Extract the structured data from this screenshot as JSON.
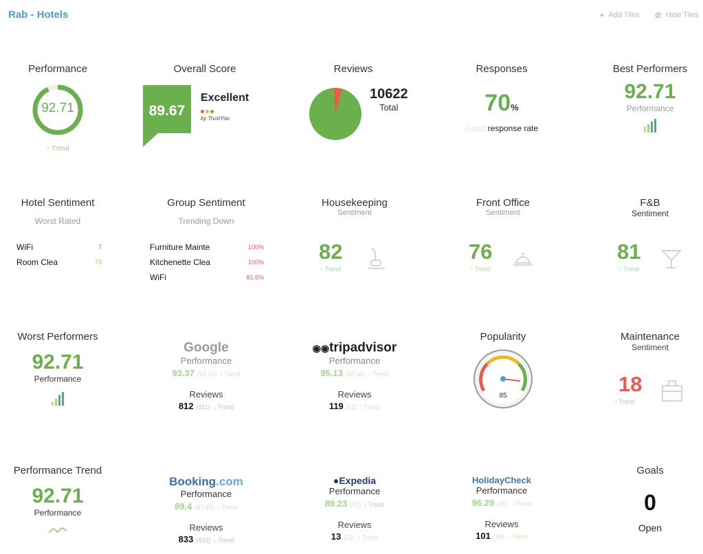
{
  "header": {
    "title": "Rab - Hotels",
    "add_tiles": "Add Tiles",
    "hide_tiles": "Hide Tiles"
  },
  "colors": {
    "green": "#6ab04c",
    "red": "#e85c4a",
    "blue": "#4aa0c8"
  },
  "performance": {
    "title": "Performance",
    "value": "92.71",
    "ring_fraction": 0.93,
    "trend": "Trend"
  },
  "overall_score": {
    "title": "Overall Score",
    "value": "89.67",
    "label": "Excellent",
    "by": "by TrustYou"
  },
  "reviews": {
    "title": "Reviews",
    "total": "10622",
    "total_label": "Total",
    "pie_negative_fraction": 0.05
  },
  "responses": {
    "title": "Responses",
    "value": "70",
    "unit": "%",
    "good": "Good",
    "rate_label": "response rate"
  },
  "best_performers": {
    "title": "Best Performers",
    "value": "92.71",
    "label": "Performance"
  },
  "hotel_sentiment": {
    "title": "Hotel Sentiment",
    "subtitle": "Worst Rated",
    "rows": [
      {
        "name": "WiFi",
        "value": "7"
      },
      {
        "name": "Room Clea",
        "value": "75"
      }
    ]
  },
  "group_sentiment": {
    "title": "Group Sentiment",
    "subtitle": "Trending Down",
    "rows": [
      {
        "name": "Furniture Mainte",
        "value": "100%"
      },
      {
        "name": "Kitchenette Clea",
        "value": "100%"
      },
      {
        "name": "WiFi",
        "value": "81.6%"
      }
    ]
  },
  "housekeeping": {
    "title": "Housekeeping",
    "subtitle": "Sentiment",
    "value": "82",
    "trend": "Trend"
  },
  "front_office": {
    "title": "Front Office",
    "subtitle": "Sentiment",
    "value": "76",
    "trend": "Trend"
  },
  "fnb": {
    "title": "F&B",
    "subtitle": "Sentiment",
    "value": "81",
    "trend": "Trend"
  },
  "worst_performers": {
    "title": "Worst Performers",
    "value": "92.71",
    "label": "Performance"
  },
  "google": {
    "logo": "Google",
    "perf_label": "Performance",
    "perf_value": "93.37",
    "perf_aux": "(93.14)",
    "perf_trend": "Trend",
    "reviews_label": "Reviews",
    "reviews_value": "812",
    "reviews_aux": "(811)",
    "reviews_trend": "Trend"
  },
  "tripadvisor": {
    "logo": "tripadvisor",
    "perf_label": "Performance",
    "perf_value": "95.13",
    "perf_aux": "(97.44)",
    "perf_trend": "Trend",
    "reviews_label": "Reviews",
    "reviews_value": "119",
    "reviews_aux": "(11)",
    "reviews_trend": "Trend"
  },
  "popularity": {
    "title": "Popularity",
    "value": "85"
  },
  "maintenance": {
    "title": "Maintenance",
    "subtitle": "Sentiment",
    "value": "18",
    "trend": "Trend"
  },
  "performance_trend": {
    "title": "Performance Trend",
    "value": "92.71",
    "label": "Performance"
  },
  "booking": {
    "logo_a": "Booking",
    "logo_b": ".com",
    "perf_label": "Performance",
    "perf_value": "89.4",
    "perf_aux": "(87.85)",
    "perf_trend": "Trend",
    "reviews_label": "Reviews",
    "reviews_value": "833",
    "reviews_aux": "(833)",
    "reviews_trend": "Trend"
  },
  "expedia": {
    "logo": "Expedia",
    "perf_label": "Performance",
    "perf_value": "89.23",
    "perf_aux": "(91)",
    "perf_trend": "Trend",
    "reviews_label": "Reviews",
    "reviews_value": "13",
    "reviews_aux": "(12)",
    "reviews_trend": "Trend"
  },
  "holidaycheck": {
    "logo": "HolidayCheck",
    "perf_label": "Performance",
    "perf_value": "96.29",
    "perf_aux": "(95)",
    "perf_trend": "Trend",
    "reviews_label": "Reviews",
    "reviews_value": "101",
    "reviews_aux": "(98)",
    "reviews_trend": "Trend"
  },
  "goals": {
    "title": "Goals",
    "value": "0",
    "label": "Open"
  }
}
